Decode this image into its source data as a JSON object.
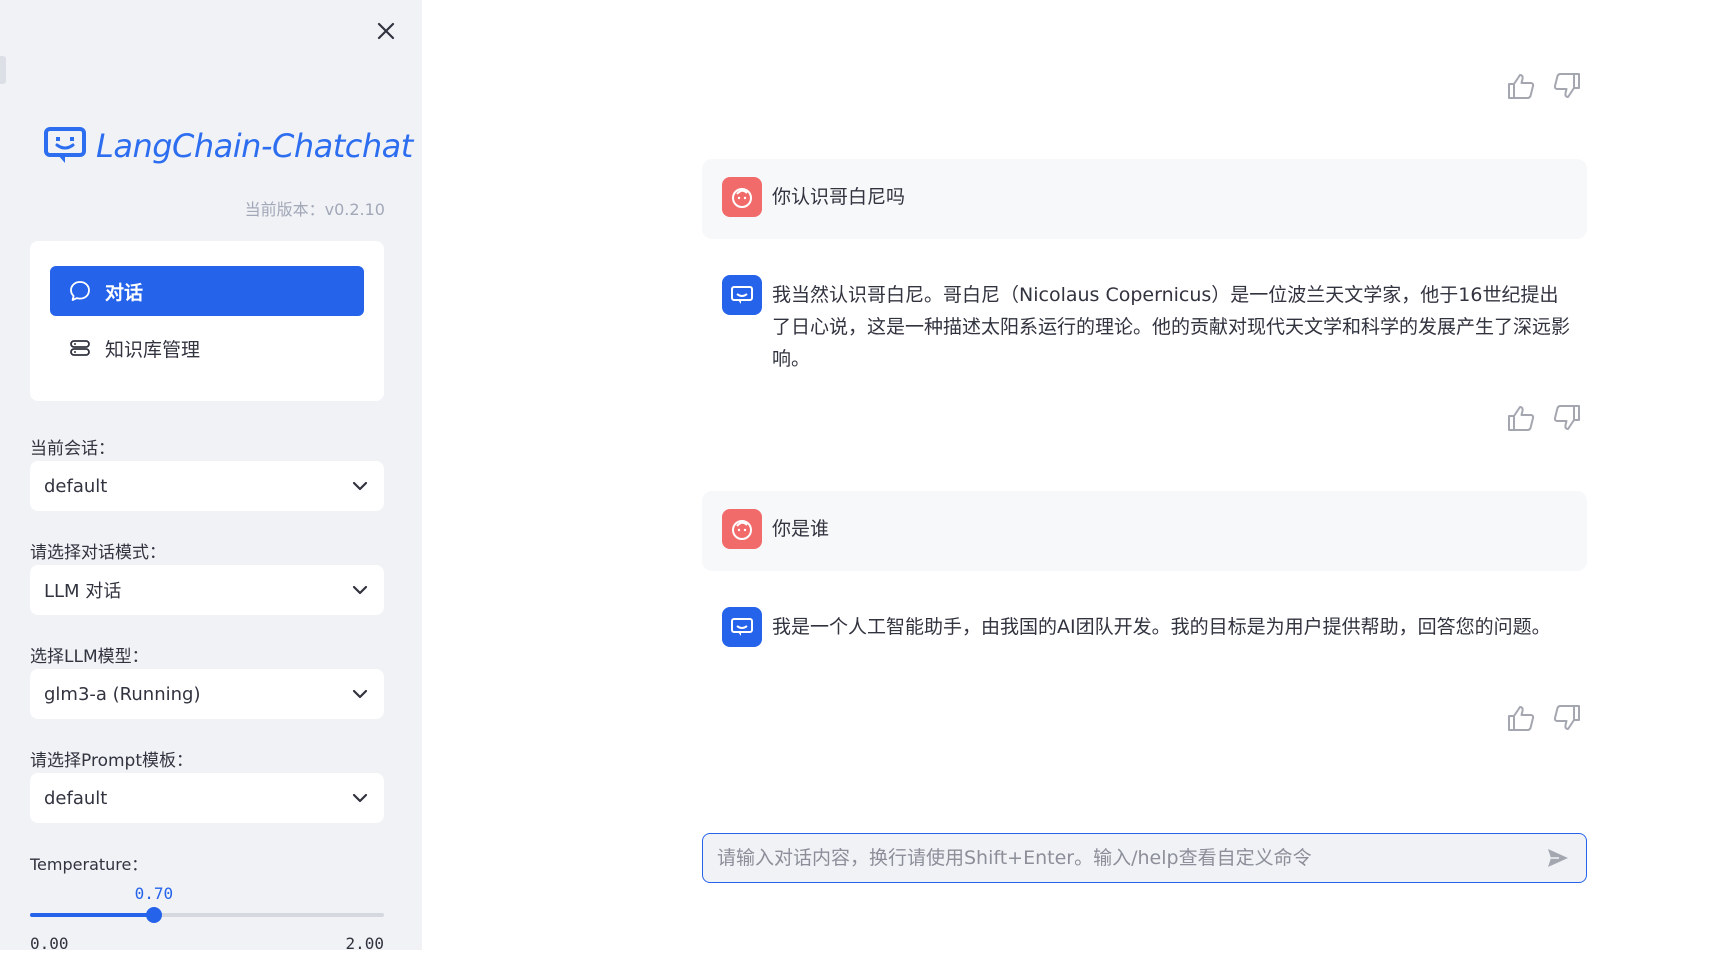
{
  "sidebar": {
    "brand": "LangChain-Chatchat",
    "version": "当前版本：v0.2.10",
    "nav": [
      {
        "label": "对话",
        "icon": "chat-bubble-icon",
        "active": true
      },
      {
        "label": "知识库管理",
        "icon": "database-icon",
        "active": false
      }
    ],
    "fields": {
      "conversation_label": "当前会话：",
      "conversation_value": "default",
      "mode_label": "请选择对话模式：",
      "mode_value": "LLM 对话",
      "model_label": "选择LLM模型：",
      "model_value": "glm3-a (Running)",
      "prompt_label": "请选择Prompt模板：",
      "prompt_value": "default"
    },
    "temperature": {
      "label": "Temperature：",
      "value": 0.7,
      "value_text": "0.70",
      "min_text": "0.00",
      "max_text": "2.00",
      "min": 0,
      "max": 2
    }
  },
  "chat": {
    "messages": [
      {
        "role": "user",
        "text": "你认识哥白尼吗"
      },
      {
        "role": "assistant",
        "text": "我当然认识哥白尼。哥白尼（Nicolaus Copernicus）是一位波兰天文学家，他于16世纪提出了日心说，这是一种描述太阳系运行的理论。他的贡献对现代天文学和科学的发展产生了深远影响。"
      },
      {
        "role": "user",
        "text": "你是谁"
      },
      {
        "role": "assistant",
        "text": "我是一个人工智能助手，由我国的AI团队开发。我的目标是为用户提供帮助，回答您的问题。"
      }
    ],
    "input_placeholder": "请输入对话内容，换行请使用Shift+Enter。输入/help查看自定义命令"
  },
  "colors": {
    "accent": "#2563eb",
    "sidebar_bg": "#f0f2f6",
    "user_avatar": "#f26b6b"
  }
}
